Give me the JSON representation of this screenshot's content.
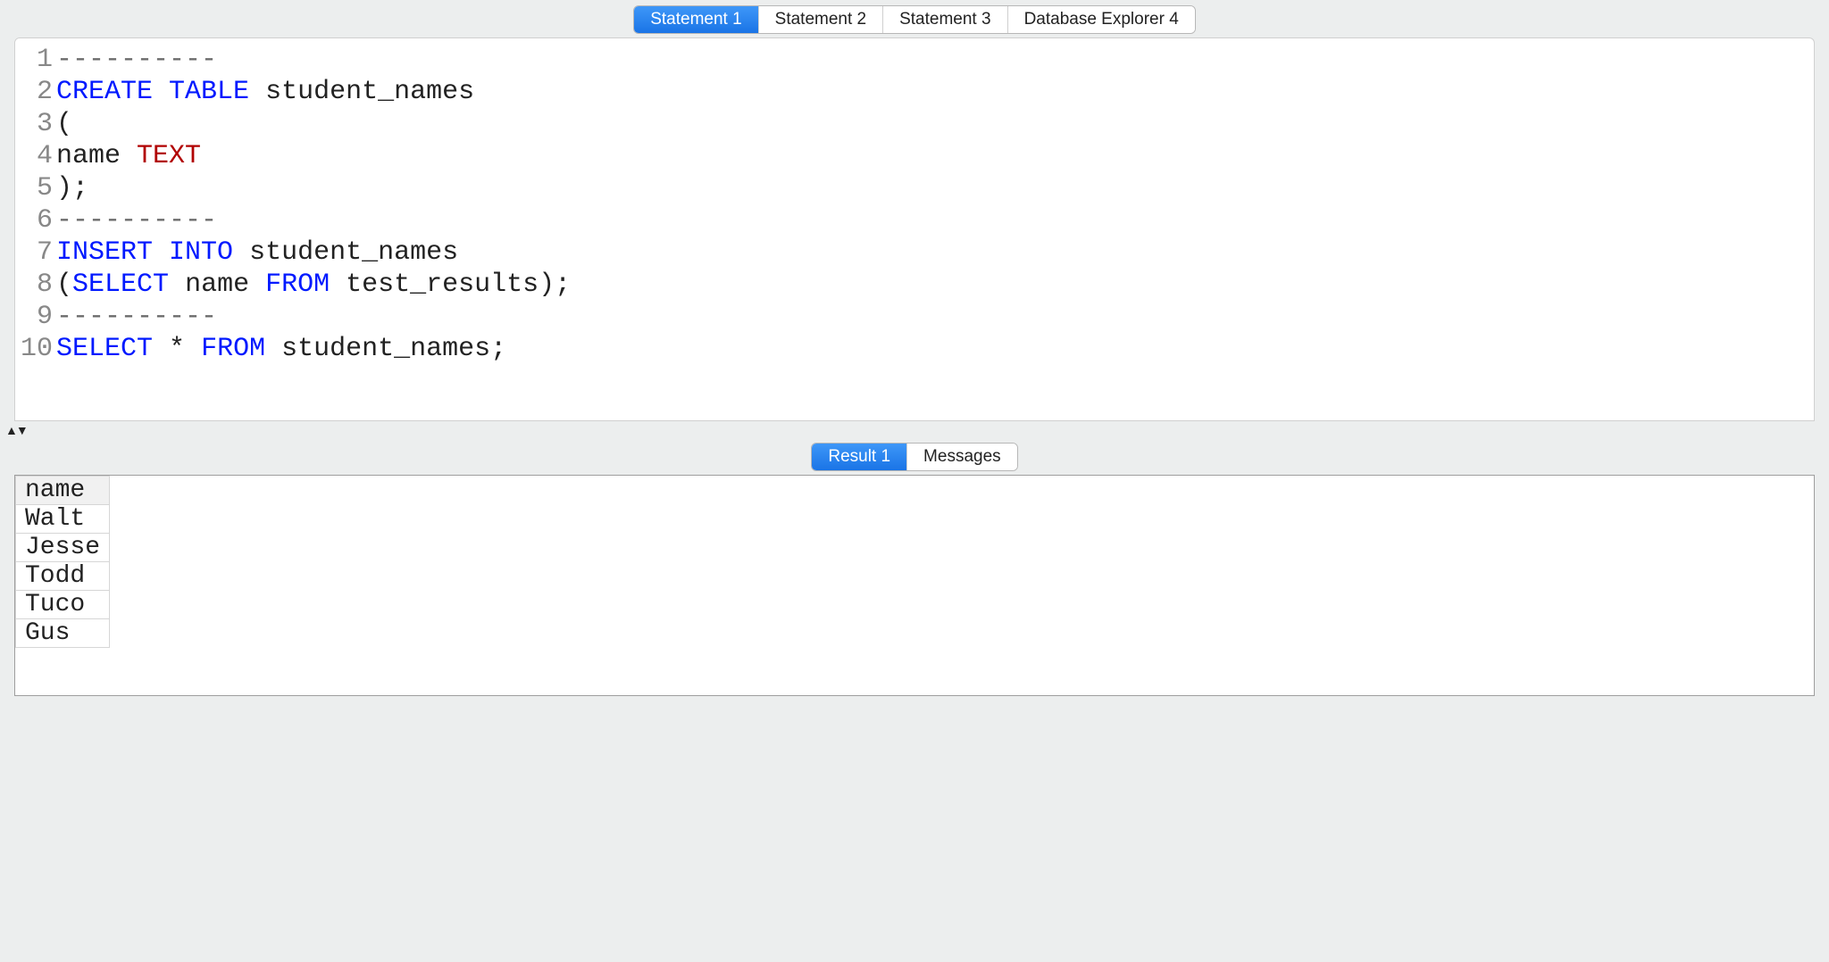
{
  "top_tabs": {
    "active_index": 0,
    "items": [
      "Statement 1",
      "Statement 2",
      "Statement 3",
      "Database Explorer 4"
    ]
  },
  "editor": {
    "lines": [
      {
        "n": "1",
        "tokens": [
          {
            "t": "----------",
            "c": "cm"
          }
        ]
      },
      {
        "n": "2",
        "tokens": [
          {
            "t": "CREATE TABLE",
            "c": "kw"
          },
          {
            "t": " student_names",
            "c": ""
          }
        ]
      },
      {
        "n": "3",
        "tokens": [
          {
            "t": "(",
            "c": ""
          }
        ]
      },
      {
        "n": "4",
        "tokens": [
          {
            "t": "name ",
            "c": ""
          },
          {
            "t": "TEXT",
            "c": "ty"
          }
        ]
      },
      {
        "n": "5",
        "tokens": [
          {
            "t": ");",
            "c": ""
          }
        ]
      },
      {
        "n": "6",
        "tokens": [
          {
            "t": "----------",
            "c": "cm"
          }
        ]
      },
      {
        "n": "7",
        "tokens": [
          {
            "t": "INSERT INTO",
            "c": "kw"
          },
          {
            "t": " student_names",
            "c": ""
          }
        ]
      },
      {
        "n": "8",
        "tokens": [
          {
            "t": "(",
            "c": ""
          },
          {
            "t": "SELECT",
            "c": "kw"
          },
          {
            "t": " name ",
            "c": ""
          },
          {
            "t": "FROM",
            "c": "kw"
          },
          {
            "t": " test_results);",
            "c": ""
          }
        ]
      },
      {
        "n": "9",
        "tokens": [
          {
            "t": "----------",
            "c": "cm"
          }
        ]
      },
      {
        "n": "10",
        "tokens": [
          {
            "t": "SELECT",
            "c": "kw"
          },
          {
            "t": " * ",
            "c": ""
          },
          {
            "t": "FROM",
            "c": "kw"
          },
          {
            "t": " student_names;",
            "c": ""
          }
        ]
      }
    ]
  },
  "result_tabs": {
    "active_index": 0,
    "items": [
      "Result 1",
      "Messages"
    ]
  },
  "result_grid": {
    "columns": [
      "name"
    ],
    "rows": [
      [
        "Walt"
      ],
      [
        "Jesse"
      ],
      [
        "Todd"
      ],
      [
        "Tuco"
      ],
      [
        "Gus"
      ]
    ]
  },
  "colors": {
    "keyword": "#0019ff",
    "type": "#b10000",
    "comment": "#6a6a6a",
    "tab_active_bg": "#1a74e6"
  }
}
